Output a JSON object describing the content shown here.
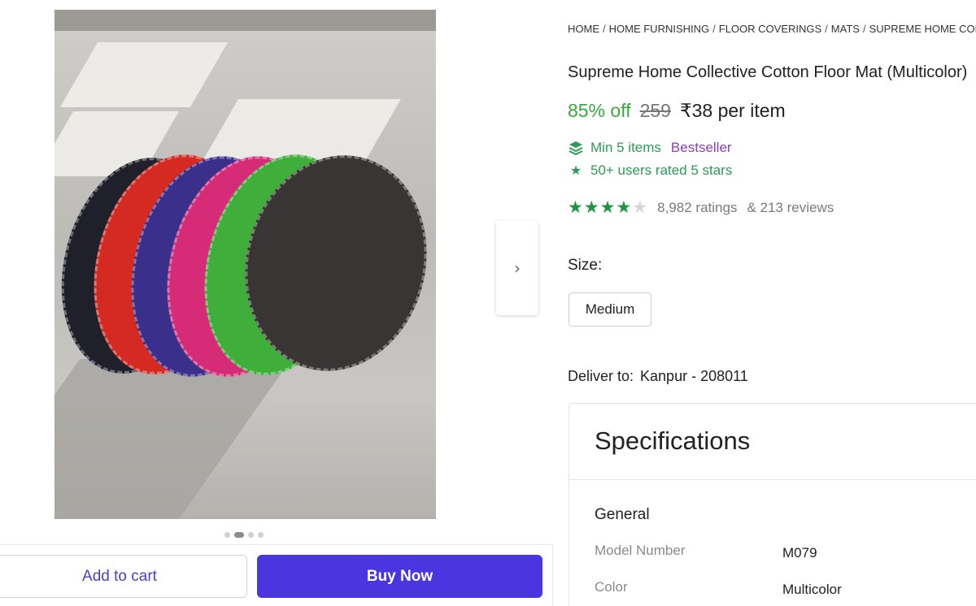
{
  "breadcrumb": [
    "HOME",
    "HOME FURNISHING",
    "FLOOR COVERINGS",
    "MATS",
    "SUPREME HOME COLLECTIVE"
  ],
  "breadcrumb_sep": "/",
  "product": {
    "title": "Supreme Home Collective Cotton Floor Mat (Multicolor)",
    "discount": "85% off",
    "mrp": "259",
    "price": "₹38 per item",
    "min_items": "Min 5 items",
    "bestseller": "Bestseller",
    "users_rated": "50+ users rated 5 stars",
    "rating_stars": 4,
    "ratings_text": "8,982 ratings",
    "reviews_text": "& 213 reviews"
  },
  "size": {
    "label": "Size:",
    "selected": "Medium"
  },
  "delivery": {
    "label": "Deliver to:",
    "location": "Kanpur - 208011"
  },
  "specifications": {
    "title": "Specifications",
    "section": "General",
    "rows": [
      {
        "key": "Model Number",
        "value": "M079"
      },
      {
        "key": "Color",
        "value": "Multicolor"
      }
    ]
  },
  "actions": {
    "add_to_cart": "Add to cart",
    "buy_now": "Buy Now"
  },
  "carousel": {
    "dot_count": 4,
    "active_index": 1
  },
  "colors": {
    "accent": "#4a35e0",
    "discount": "#38a83c",
    "star": "#1e9641",
    "bestseller": "#8a3fb5"
  },
  "icons": {
    "next": "chevron-right-icon",
    "min_items": "stack-icon",
    "users_rated": "star-badge-icon"
  }
}
